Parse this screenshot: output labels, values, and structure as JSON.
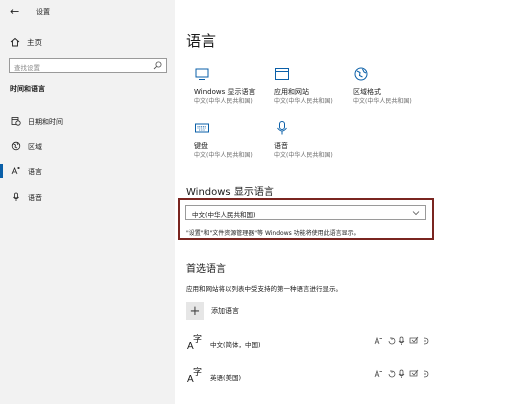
{
  "window": {
    "title": "设置",
    "back_glyph": "←",
    "minimize_glyph": "—",
    "maximize_glyph": "☐",
    "close_glyph": "✕"
  },
  "sidebar": {
    "home_label": "主页",
    "search_placeholder": "查找设置",
    "group_title": "时间和语言",
    "items": [
      {
        "label": "日期和时间",
        "icon": "calendar-clock-icon"
      },
      {
        "label": "区域",
        "icon": "globe-icon"
      },
      {
        "label": "语言",
        "icon": "language-icon",
        "active": true
      },
      {
        "label": "语音",
        "icon": "microphone-icon"
      }
    ]
  },
  "main": {
    "page_title": "语言",
    "tiles": [
      {
        "name": "Windows 显示语言",
        "desc": "中文(中华人民共和国)",
        "icon": "monitor-icon"
      },
      {
        "name": "应用和网站",
        "desc": "中文(中华人民共和国)",
        "icon": "window-icon"
      },
      {
        "name": "区域格式",
        "desc": "中文(中华人民共和国)",
        "icon": "globe-icon"
      },
      {
        "name": "键盘",
        "desc": "中文(中华人民共和国)",
        "icon": "keyboard-icon"
      },
      {
        "name": "语音",
        "desc": "中文(中华人民共和国)",
        "icon": "microphone-icon"
      }
    ],
    "display_section": {
      "title": "Windows 显示语言",
      "selected": "中文(中华人民共和国)",
      "note": "\"设置\"和\"文件资源管理器\"等 Windows 功能将使用此语言显示。"
    },
    "preferred_section": {
      "title": "首选语言",
      "desc": "应用和网站将以列表中受支持的第一种语言进行显示。",
      "add_label": "添加语言",
      "add_glyph": "+",
      "languages": [
        {
          "label": "中文(简体，中国)"
        },
        {
          "label": "英语(美国)"
        }
      ]
    }
  },
  "colors": {
    "accent": "#0a5fa8",
    "highlight_border": "#7a2520",
    "sidebar_bg": "#f2f2f2"
  }
}
